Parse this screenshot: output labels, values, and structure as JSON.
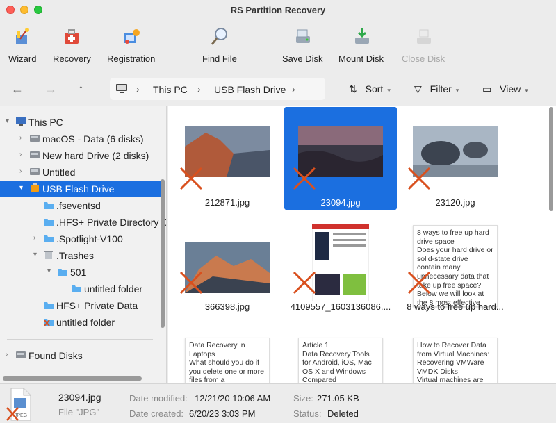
{
  "window": {
    "title": "RS Partition Recovery"
  },
  "toolbar": [
    {
      "label": "Wizard",
      "icon": "wizard-icon"
    },
    {
      "label": "Recovery",
      "icon": "recovery-kit-icon"
    },
    {
      "label": "Registration",
      "icon": "registration-icon"
    },
    {
      "label": "Find File",
      "icon": "magnifier-icon"
    },
    {
      "label": "Save Disk",
      "icon": "save-disk-icon"
    },
    {
      "label": "Mount Disk",
      "icon": "mount-disk-icon"
    },
    {
      "label": "Close Disk",
      "icon": "close-disk-icon",
      "disabled": true
    }
  ],
  "nav": {
    "path": [
      "This PC",
      "USB Flash Drive"
    ],
    "sort": "Sort",
    "filter": "Filter",
    "view": "View"
  },
  "tree": [
    {
      "label": "This PC",
      "icon": "computer-icon",
      "expand": "open"
    },
    {
      "label": "macOS - Data (6 disks)",
      "icon": "hard-disk-icon",
      "expand": "closed"
    },
    {
      "label": "New hard Drive (2 disks)",
      "icon": "hard-disk-icon",
      "expand": "closed"
    },
    {
      "label": "Untitled",
      "icon": "hard-disk-icon",
      "expand": "closed"
    },
    {
      "label": "USB Flash Drive",
      "icon": "usb-drive-icon",
      "expand": "open",
      "selected": true
    },
    {
      "label": ".fseventsd",
      "icon": "folder-icon"
    },
    {
      "label": ".HFS+ Private Directory Data",
      "icon": "folder-icon"
    },
    {
      "label": ".Spotlight-V100",
      "icon": "folder-icon",
      "expand": "closed"
    },
    {
      "label": ".Trashes",
      "icon": "trash-icon",
      "expand": "open"
    },
    {
      "label": "501",
      "icon": "folder-icon",
      "expand": "open"
    },
    {
      "label": "untitled folder",
      "icon": "folder-icon"
    },
    {
      "label": "HFS+ Private Data",
      "icon": "folder-icon"
    },
    {
      "label": "untitled folder",
      "icon": "deleted-folder-icon"
    },
    {
      "label": "Found Disks",
      "icon": "hard-disk-icon",
      "expand": "closed"
    }
  ],
  "files": [
    {
      "name": "212871.jpg",
      "kind": "mountain-photo"
    },
    {
      "name": "23094.jpg",
      "kind": "sunset-photo",
      "selected": true
    },
    {
      "name": "23120.jpg",
      "kind": "rocks-photo"
    },
    {
      "name": "366398.jpg",
      "kind": "peak-photo"
    },
    {
      "name": "4109557_1603136086....",
      "kind": "magazine-page"
    },
    {
      "name": "8 ways to free up hard...",
      "kind": "text",
      "preview": "8 ways to free up hard drive space\nDoes your hard drive or solid-state drive contain many unnecessary data that take up free space? Below we will look at the 8 most effective"
    },
    {
      "name": "",
      "kind": "text",
      "preview": "Data Recovery in Laptops\nWhat should you do if you delete one or more files from a"
    },
    {
      "name": "",
      "kind": "text",
      "preview": "Article 1\nData Recovery Tools for Android, iOS, Mac OS X and Windows Compared"
    },
    {
      "name": "",
      "kind": "text",
      "preview": "How to Recover Data from Virtual Machines: Recovering VMWare VMDK Disks\nVirtual machines are"
    }
  ],
  "status": {
    "filename": "23094.jpg",
    "filetype": "File \"JPG\"",
    "modified_label": "Date modified:",
    "modified": "12/21/20 10:06 AM",
    "created_label": "Date created:",
    "created": "6/20/23 3:03 PM",
    "size_label": "Size:",
    "size": "271.05 KB",
    "status_label": "Status:",
    "status": "Deleted",
    "icon_caption": "JPEG"
  },
  "colors": {
    "accent": "#1b6fe0",
    "deleted_mark": "#d9501e"
  }
}
